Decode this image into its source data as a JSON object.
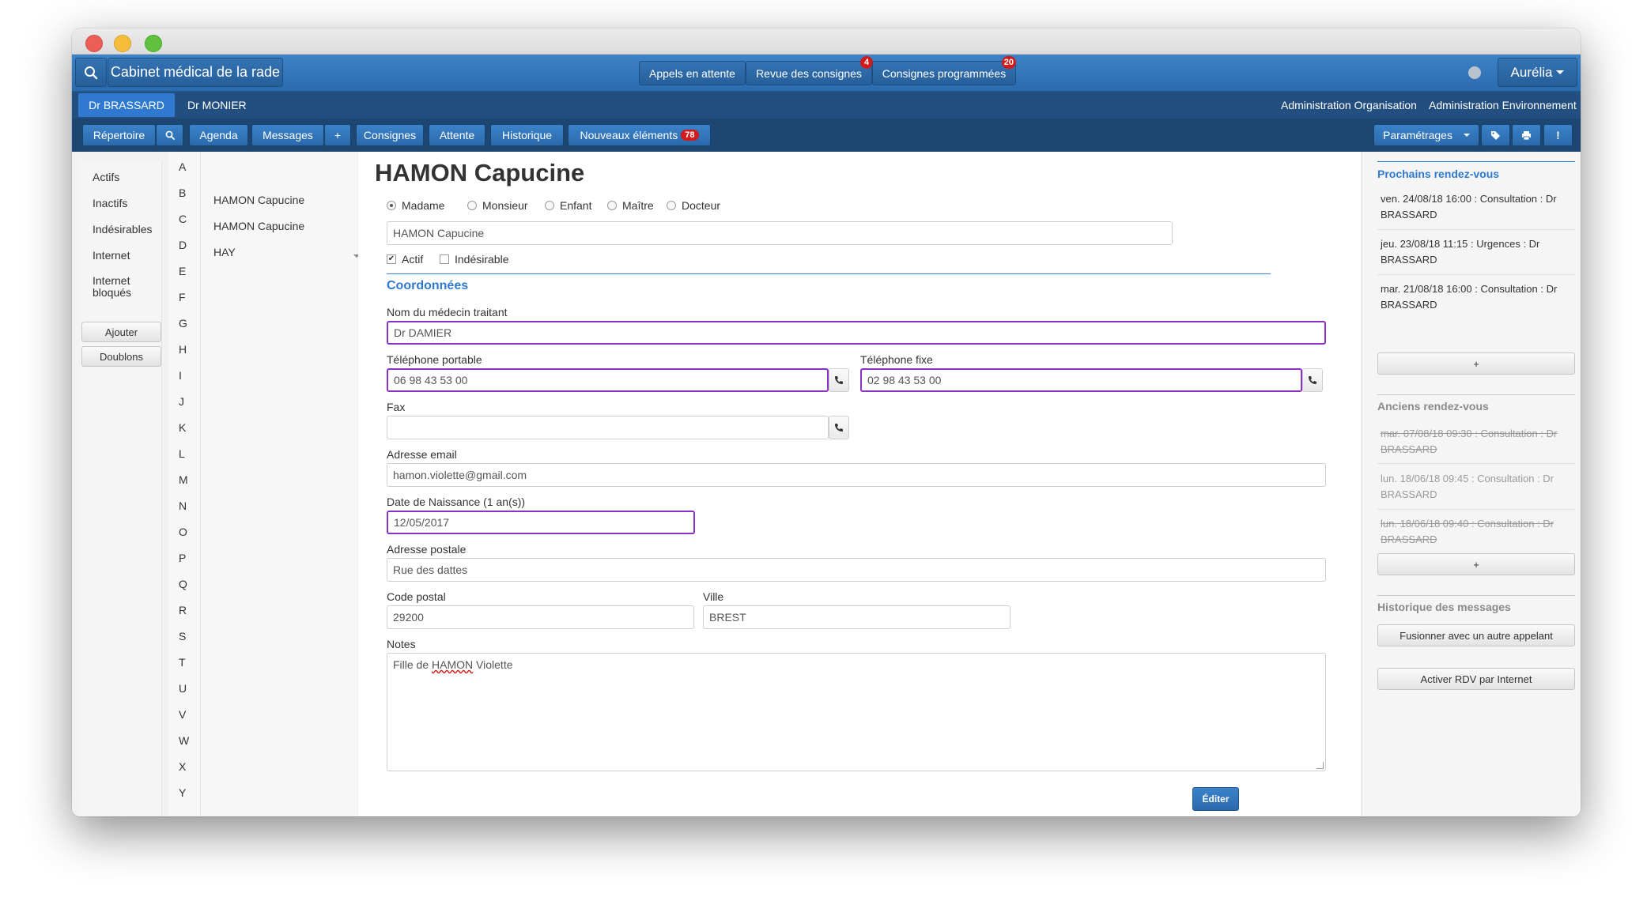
{
  "topbar": {
    "app_title": "Cabinet médical de la rade",
    "center_buttons": [
      {
        "label": "Appels en attente"
      },
      {
        "label": "Revue des consignes",
        "badge": "4"
      },
      {
        "label": "Consignes programmées",
        "badge": "20"
      }
    ],
    "user_menu": "Aurélia"
  },
  "doctors": [
    "Dr BRASSARD",
    "Dr MONIER"
  ],
  "admin_links": [
    "Administration Organisation",
    "Administration Environnement"
  ],
  "nav_tabs": {
    "repertoire": "Répertoire",
    "agenda": "Agenda",
    "messages": "Messages",
    "plus": "+",
    "consignes": "Consignes",
    "attente": "Attente",
    "historique": "Historique",
    "nouveaux": "Nouveaux éléments",
    "nouveaux_badge": "78",
    "parametrages": "Paramétrages"
  },
  "filters": {
    "items": [
      "Actifs",
      "Inactifs",
      "Indésirables",
      "Internet",
      "Internet bloqués"
    ],
    "buttons": [
      "Ajouter",
      "Doublons"
    ]
  },
  "letters": [
    "A",
    "B",
    "C",
    "D",
    "E",
    "F",
    "G",
    "H",
    "I",
    "J",
    "K",
    "L",
    "M",
    "N",
    "O",
    "P",
    "Q",
    "R",
    "S",
    "T",
    "U",
    "V",
    "W",
    "X",
    "Y"
  ],
  "names": [
    "HAMON Capucine",
    "HAMON Capucine",
    "HAY"
  ],
  "patient": {
    "heading": "HAMON Capucine",
    "civility_options": [
      "Madame",
      "Monsieur",
      "Enfant",
      "Maître",
      "Docteur"
    ],
    "civility_selected": "Madame",
    "full_name": "HAMON Capucine",
    "actif_label": "Actif",
    "indesirable_label": "Indésirable",
    "section_title": "Coordonnées",
    "medecin_label": "Nom du médecin traitant",
    "medecin_value": "Dr DAMIER",
    "tel_portable_label": "Téléphone portable",
    "tel_portable_value": "06 98 43 53 00",
    "tel_fixe_label": "Téléphone fixe",
    "tel_fixe_value": "02 98 43 53 00",
    "fax_label": "Fax",
    "fax_value": "",
    "email_label": "Adresse email",
    "email_value": "hamon.violette@gmail.com",
    "dob_label": "Date de Naissance (1 an(s))",
    "dob_value": "12/05/2017",
    "address_label": "Adresse postale",
    "address_value": "Rue des dattes",
    "cp_label": "Code postal",
    "cp_value": "29200",
    "ville_label": "Ville",
    "ville_value": "BREST",
    "notes_label": "Notes",
    "notes_pre": "Fille de ",
    "notes_name": "HAMON",
    "notes_post": " Violette",
    "edit_button": "Éditer"
  },
  "right": {
    "upcoming_title": "Prochains rendez-vous",
    "upcoming": [
      "ven. 24/08/18 16:00 : Consultation : Dr BRASSARD",
      "jeu. 23/08/18 11:15 : Urgences : Dr BRASSARD",
      "mar. 21/08/18 16:00 : Consultation : Dr BRASSARD"
    ],
    "plus": "+",
    "past_title": "Anciens rendez-vous",
    "past": [
      "mar. 07/08/18 09:30 : Consultation : Dr BRASSARD",
      "lun. 18/06/18 09:45 : Consultation : Dr BRASSARD",
      "lun. 18/06/18 09:40 : Consultation : Dr BRASSARD"
    ],
    "history_title": "Historique des messages",
    "merge_button": "Fusionner avec un autre appelant",
    "activate_button": "Activer RDV par Internet"
  },
  "colors": {
    "accent_blue": "#2f7ad0",
    "focus_purple": "#8b2fc9",
    "badge_red": "#d11a1a"
  }
}
